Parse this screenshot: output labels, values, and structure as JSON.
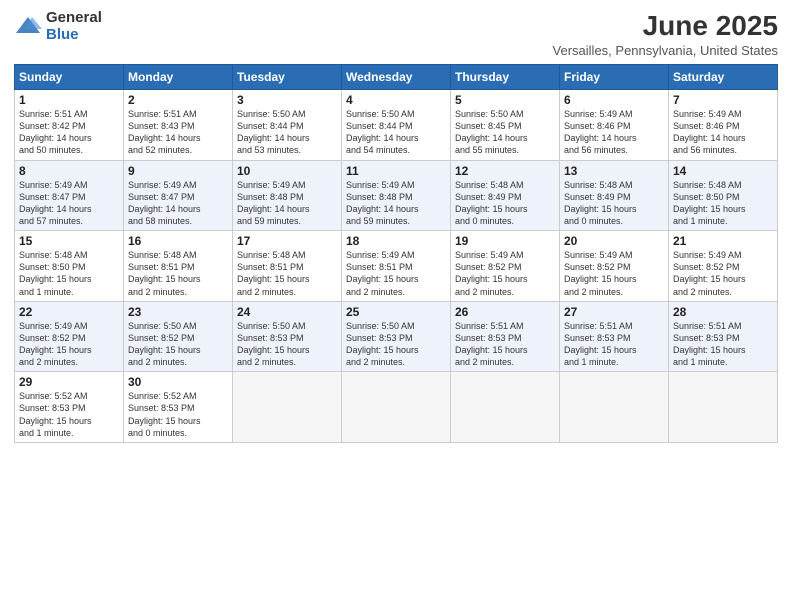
{
  "logo": {
    "general": "General",
    "blue": "Blue"
  },
  "title": "June 2025",
  "subtitle": "Versailles, Pennsylvania, United States",
  "days_of_week": [
    "Sunday",
    "Monday",
    "Tuesday",
    "Wednesday",
    "Thursday",
    "Friday",
    "Saturday"
  ],
  "weeks": [
    [
      {
        "day": "1",
        "info": "Sunrise: 5:51 AM\nSunset: 8:42 PM\nDaylight: 14 hours\nand 50 minutes."
      },
      {
        "day": "2",
        "info": "Sunrise: 5:51 AM\nSunset: 8:43 PM\nDaylight: 14 hours\nand 52 minutes."
      },
      {
        "day": "3",
        "info": "Sunrise: 5:50 AM\nSunset: 8:44 PM\nDaylight: 14 hours\nand 53 minutes."
      },
      {
        "day": "4",
        "info": "Sunrise: 5:50 AM\nSunset: 8:44 PM\nDaylight: 14 hours\nand 54 minutes."
      },
      {
        "day": "5",
        "info": "Sunrise: 5:50 AM\nSunset: 8:45 PM\nDaylight: 14 hours\nand 55 minutes."
      },
      {
        "day": "6",
        "info": "Sunrise: 5:49 AM\nSunset: 8:46 PM\nDaylight: 14 hours\nand 56 minutes."
      },
      {
        "day": "7",
        "info": "Sunrise: 5:49 AM\nSunset: 8:46 PM\nDaylight: 14 hours\nand 56 minutes."
      }
    ],
    [
      {
        "day": "8",
        "info": "Sunrise: 5:49 AM\nSunset: 8:47 PM\nDaylight: 14 hours\nand 57 minutes."
      },
      {
        "day": "9",
        "info": "Sunrise: 5:49 AM\nSunset: 8:47 PM\nDaylight: 14 hours\nand 58 minutes."
      },
      {
        "day": "10",
        "info": "Sunrise: 5:49 AM\nSunset: 8:48 PM\nDaylight: 14 hours\nand 59 minutes."
      },
      {
        "day": "11",
        "info": "Sunrise: 5:49 AM\nSunset: 8:48 PM\nDaylight: 14 hours\nand 59 minutes."
      },
      {
        "day": "12",
        "info": "Sunrise: 5:48 AM\nSunset: 8:49 PM\nDaylight: 15 hours\nand 0 minutes."
      },
      {
        "day": "13",
        "info": "Sunrise: 5:48 AM\nSunset: 8:49 PM\nDaylight: 15 hours\nand 0 minutes."
      },
      {
        "day": "14",
        "info": "Sunrise: 5:48 AM\nSunset: 8:50 PM\nDaylight: 15 hours\nand 1 minute."
      }
    ],
    [
      {
        "day": "15",
        "info": "Sunrise: 5:48 AM\nSunset: 8:50 PM\nDaylight: 15 hours\nand 1 minute."
      },
      {
        "day": "16",
        "info": "Sunrise: 5:48 AM\nSunset: 8:51 PM\nDaylight: 15 hours\nand 2 minutes."
      },
      {
        "day": "17",
        "info": "Sunrise: 5:48 AM\nSunset: 8:51 PM\nDaylight: 15 hours\nand 2 minutes."
      },
      {
        "day": "18",
        "info": "Sunrise: 5:49 AM\nSunset: 8:51 PM\nDaylight: 15 hours\nand 2 minutes."
      },
      {
        "day": "19",
        "info": "Sunrise: 5:49 AM\nSunset: 8:52 PM\nDaylight: 15 hours\nand 2 minutes."
      },
      {
        "day": "20",
        "info": "Sunrise: 5:49 AM\nSunset: 8:52 PM\nDaylight: 15 hours\nand 2 minutes."
      },
      {
        "day": "21",
        "info": "Sunrise: 5:49 AM\nSunset: 8:52 PM\nDaylight: 15 hours\nand 2 minutes."
      }
    ],
    [
      {
        "day": "22",
        "info": "Sunrise: 5:49 AM\nSunset: 8:52 PM\nDaylight: 15 hours\nand 2 minutes."
      },
      {
        "day": "23",
        "info": "Sunrise: 5:50 AM\nSunset: 8:52 PM\nDaylight: 15 hours\nand 2 minutes."
      },
      {
        "day": "24",
        "info": "Sunrise: 5:50 AM\nSunset: 8:53 PM\nDaylight: 15 hours\nand 2 minutes."
      },
      {
        "day": "25",
        "info": "Sunrise: 5:50 AM\nSunset: 8:53 PM\nDaylight: 15 hours\nand 2 minutes."
      },
      {
        "day": "26",
        "info": "Sunrise: 5:51 AM\nSunset: 8:53 PM\nDaylight: 15 hours\nand 2 minutes."
      },
      {
        "day": "27",
        "info": "Sunrise: 5:51 AM\nSunset: 8:53 PM\nDaylight: 15 hours\nand 1 minute."
      },
      {
        "day": "28",
        "info": "Sunrise: 5:51 AM\nSunset: 8:53 PM\nDaylight: 15 hours\nand 1 minute."
      }
    ],
    [
      {
        "day": "29",
        "info": "Sunrise: 5:52 AM\nSunset: 8:53 PM\nDaylight: 15 hours\nand 1 minute."
      },
      {
        "day": "30",
        "info": "Sunrise: 5:52 AM\nSunset: 8:53 PM\nDaylight: 15 hours\nand 0 minutes."
      },
      null,
      null,
      null,
      null,
      null
    ]
  ]
}
